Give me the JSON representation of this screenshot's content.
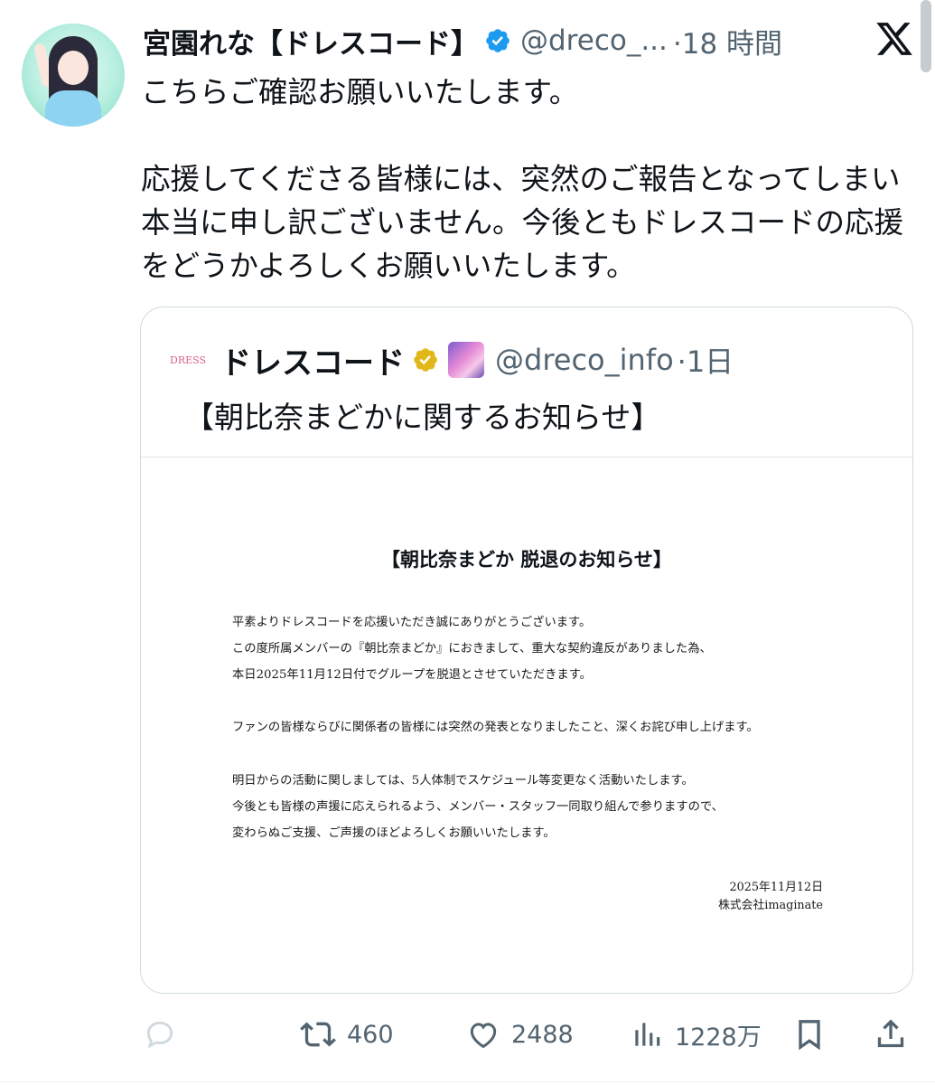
{
  "tweet": {
    "author_name": "宮園れな【ドレスコード】",
    "author_handle": "@dreco_...",
    "time": "·18 時間",
    "body": "こちらご確認お願いいたします。\n\n応援してくださる皆様には、突然のご報告となってしまい本当に申し訳ございません。今後ともドレスコードの応援をどうかよろしくお願いいたします。"
  },
  "quote": {
    "logo_text": "DRESS",
    "name": "ドレスコード",
    "handle": "@dreco_info",
    "time": "·1日",
    "text": "【朝比奈まどかに関するお知らせ】"
  },
  "notice": {
    "title": "【朝比奈まどか 脱退のお知らせ】",
    "lines": [
      "平素よりドレスコードを応援いただき誠にありがとうございます。",
      "この度所属メンバーの『朝比奈まどか』におきまして、重大な契約違反がありました為、",
      "本日2025年11月12日付でグループを脱退とさせていただきます。",
      "ファンの皆様ならびに関係者の皆様には突然の発表となりましたこと、深くお詫び申し上げます。",
      "明日からの活動に関しましては、5人体制でスケジュール等変更なく活動いたします。",
      "今後とも皆様の声援に応えられるよう、メンバー・スタッフ一同取り組んで参りますので、",
      "変わらぬご支援、ご声援のほどよろしくお願いいたします。"
    ],
    "date": "2025年11月12日",
    "company": "株式会社imaginate"
  },
  "actions": {
    "retweets": "460",
    "likes": "2488",
    "views": "1228万"
  },
  "icons": {
    "verified_color": "#1d9bf0",
    "org_badge_color": "#e2b719",
    "muted_color": "#536471"
  }
}
